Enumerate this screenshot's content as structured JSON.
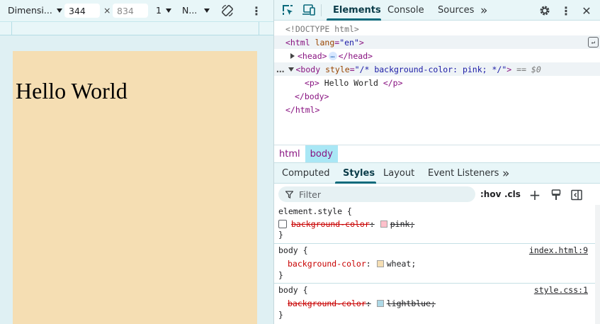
{
  "device_toolbar": {
    "dimensions_label": "Dimensi...",
    "width_value": "344",
    "times": "×",
    "height_placeholder": "834",
    "zoom_label": "1",
    "throttle_label": "N..."
  },
  "page": {
    "paragraph_text": "Hello World",
    "background_color": "#f5deb3"
  },
  "devtools": {
    "tabs": [
      {
        "label": "Elements",
        "active": true
      },
      {
        "label": "Console",
        "active": false
      },
      {
        "label": "Sources",
        "active": false
      }
    ],
    "more_tabs": "»",
    "dom": {
      "doctype": "<!DOCTYPE html>",
      "html_open_tag": "<html",
      "html_attr_name": "lang",
      "html_attr_eq": "=",
      "html_attr_value": "\"en\"",
      "html_open_close": ">",
      "head_open": "<head>",
      "head_ellipsis": "…",
      "head_close": "</head>",
      "body_line_dots": "…",
      "body_open_tag": "<body",
      "body_attr_name": "style",
      "body_attr_eq": "=",
      "body_attr_value": "\"/* background-color: pink; */\"",
      "body_open_close": ">",
      "body_selected_marker": "== $0",
      "p_open": "<p>",
      "p_text": "Hello World",
      "p_close": "</p>",
      "body_close": "</body>",
      "html_close": "</html>"
    },
    "breadcrumbs": [
      {
        "label": "html",
        "active": false
      },
      {
        "label": "body",
        "active": true
      }
    ],
    "subtabs": [
      {
        "label": "Computed",
        "active": false
      },
      {
        "label": "Styles",
        "active": true
      },
      {
        "label": "Layout",
        "active": false
      },
      {
        "label": "Event Listeners",
        "active": false
      }
    ],
    "subtabs_more": "»",
    "filter_placeholder": "Filter",
    "hov_label": ":hov",
    "cls_label": ".cls",
    "styles": {
      "rule1": {
        "selector": "element.style {",
        "prop": "background-color",
        "colon": ":",
        "value": "pink;",
        "swatch": "#ffc0cb",
        "close": "}"
      },
      "rule2": {
        "selector": "body {",
        "source": "index.html:9",
        "prop": "background-color",
        "colon": ":",
        "value": "wheat;",
        "swatch": "#f5deb3",
        "close": "}"
      },
      "rule3": {
        "selector": "body {",
        "source": "style.css:1",
        "prop": "background-color",
        "colon": ":",
        "value": "lightblue;",
        "swatch": "#add8e6",
        "close": "}"
      }
    }
  }
}
